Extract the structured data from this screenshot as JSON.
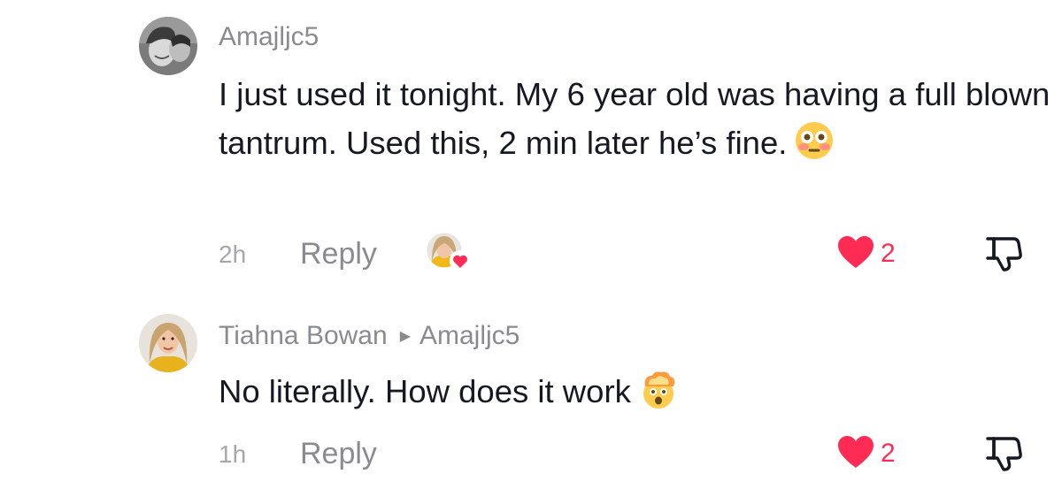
{
  "comments": [
    {
      "username": "Amajljc5",
      "text": "I just used it tonight. My 6 year old was having a full blown tantrum. Used this, 2 min later he’s fine.",
      "emoji": "flushed-face-emoji",
      "time": "2h",
      "reply_label": "Reply",
      "like_count": "2",
      "creator_liked": true
    },
    {
      "username": "Tiahna Bowan",
      "reply_to": "Amajljc5",
      "text": "No literally. How does it work",
      "emoji": "exploding-head-emoji",
      "time": "1h",
      "reply_label": "Reply",
      "like_count": "2",
      "creator_liked": false
    }
  ],
  "colors": {
    "like": "#fe2c55",
    "username": "#8a8b91",
    "body": "#161823",
    "timestamp": "#a6a7ab"
  }
}
